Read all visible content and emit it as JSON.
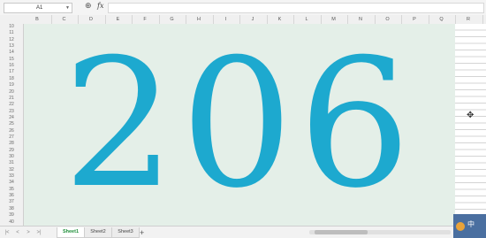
{
  "formula_bar": {
    "name_box": "A1",
    "fx_label": "fx",
    "zoom_icon": "magnifier-icon"
  },
  "columns": [
    "B",
    "C",
    "D",
    "E",
    "F",
    "G",
    "H",
    "I",
    "J",
    "K",
    "L",
    "M",
    "N",
    "O",
    "P",
    "Q",
    "R"
  ],
  "rows": [
    "10",
    "11",
    "12",
    "13",
    "14",
    "15",
    "16",
    "17",
    "18",
    "19",
    "20",
    "21",
    "22",
    "23",
    "24",
    "25",
    "26",
    "27",
    "28",
    "29",
    "30",
    "31",
    "32",
    "33",
    "34",
    "35",
    "36",
    "37",
    "38",
    "39",
    "40"
  ],
  "main": {
    "number": "206",
    "number_color": "#1da9cf",
    "panel_color": "#e4efe8"
  },
  "sheets": {
    "tabs": [
      "Sheet1",
      "Sheet2",
      "Sheet3"
    ],
    "active": "Sheet1",
    "add_label": "+",
    "nav": [
      "|<",
      "<",
      ">",
      ">|"
    ]
  },
  "badge": {
    "text": "中"
  }
}
